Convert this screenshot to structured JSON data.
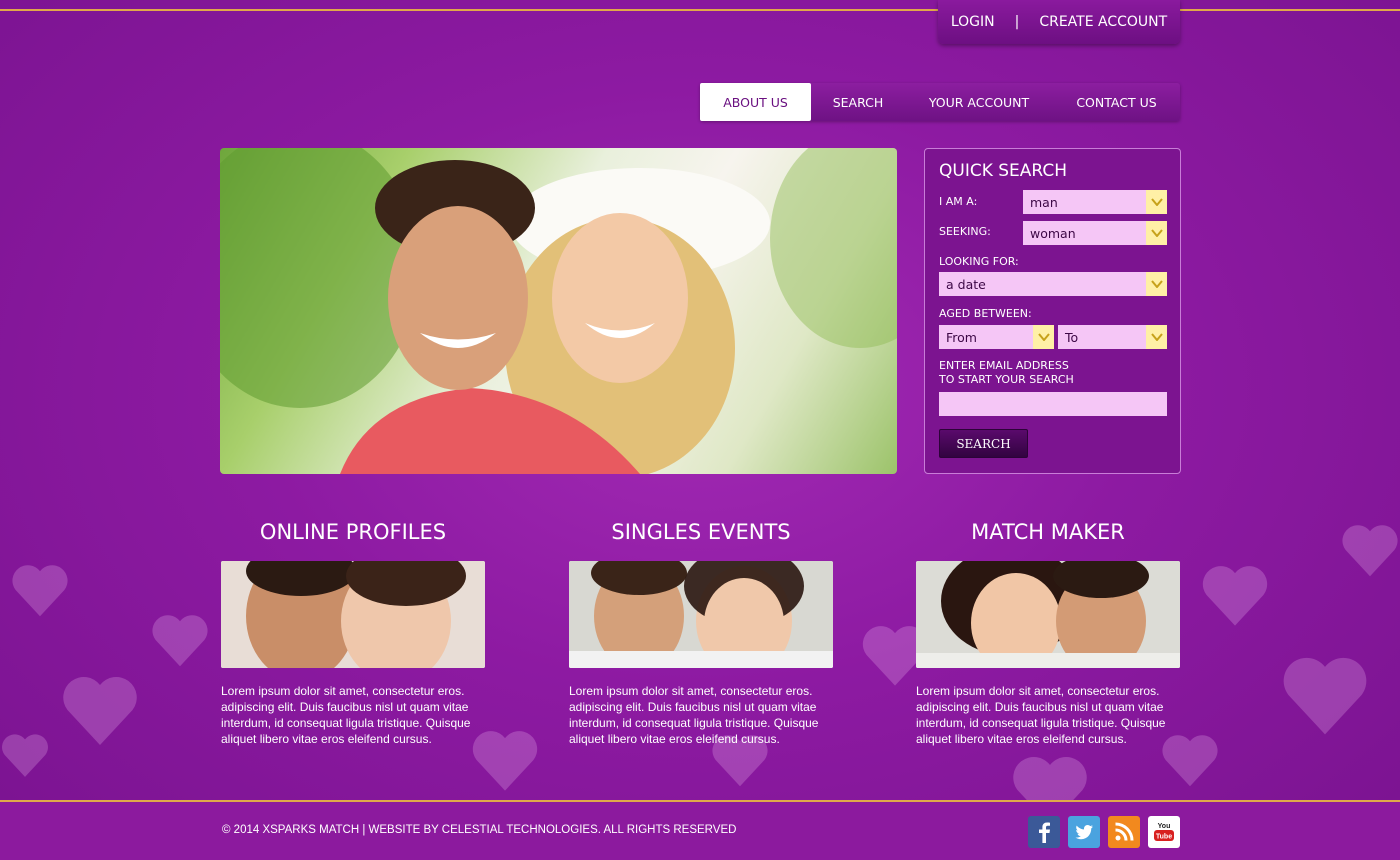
{
  "header": {
    "login_label": "LOGIN",
    "separator": "|",
    "create_account_label": "CREATE ACCOUNT"
  },
  "nav": {
    "items": [
      {
        "label": "ABOUT US",
        "active": true
      },
      {
        "label": "SEARCH",
        "active": false
      },
      {
        "label": "YOUR ACCOUNT",
        "active": false
      },
      {
        "label": "CONTACT US",
        "active": false
      }
    ]
  },
  "quick_search": {
    "title": "QUICK SEARCH",
    "i_am_label": "I AM A:",
    "i_am_value": "man",
    "seeking_label": "SEEKING:",
    "seeking_value": "woman",
    "looking_for_label": "LOOKING FOR:",
    "looking_for_value": "a date",
    "aged_label": "AGED BETWEEN:",
    "aged_from": "From",
    "aged_to": "To",
    "email_label_line1": "ENTER EMAIL ADDRESS",
    "email_label_line2": "TO START YOUR SEARCH",
    "email_value": "",
    "search_button": "SEARCH"
  },
  "features": [
    {
      "title": "ONLINE PROFILES",
      "text": "Lorem ipsum dolor sit amet, consectetur eros. adipiscing elit. Duis faucibus nisl ut quam vitae interdum, id consequat ligula tristique. Quisque aliquet libero vitae eros eleifend cursus."
    },
    {
      "title": "SINGLES EVENTS",
      "text": "Lorem ipsum dolor sit amet, consectetur eros. adipiscing elit. Duis faucibus nisl ut quam vitae interdum, id consequat ligula tristique. Quisque aliquet libero vitae eros eleifend cursus."
    },
    {
      "title": "MATCH MAKER",
      "text": "Lorem ipsum dolor sit amet, consectetur eros. adipiscing elit. Duis faucibus nisl ut quam vitae interdum, id consequat ligula tristique. Quisque aliquet libero vitae eros eleifend cursus."
    }
  ],
  "footer": {
    "copyright": "© 2014 XSPARKS MATCH | WEBSITE BY CELESTIAL TECHNOLOGIES. ALL RIGHTS RESERVED"
  },
  "social": [
    {
      "icon": "facebook-icon",
      "color": "#3b5998"
    },
    {
      "icon": "twitter-icon",
      "color": "#4aa3df"
    },
    {
      "icon": "rss-icon",
      "color": "#f2891e"
    },
    {
      "icon": "youtube-icon",
      "color": "#ffffff"
    }
  ],
  "colors": {
    "background": "#8d1aa2",
    "accent_line": "#e0a84a",
    "select_bg": "#f5c6f6",
    "select_arrow_bg": "#fff0a6"
  }
}
